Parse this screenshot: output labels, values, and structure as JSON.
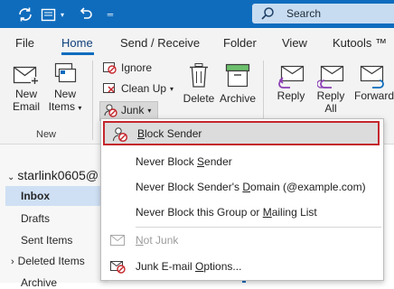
{
  "titlebar": {
    "search_placeholder": "Search",
    "accent": "#0f6cbd"
  },
  "tabs": [
    {
      "label": "File"
    },
    {
      "label": "Home"
    },
    {
      "label": "Send / Receive"
    },
    {
      "label": "Folder"
    },
    {
      "label": "View"
    },
    {
      "label": "Kutools ™"
    }
  ],
  "ribbon": {
    "new_email": "New\nEmail",
    "new_email_l1": "New",
    "new_email_l2": "Email",
    "new_items_l1": "New",
    "new_items_l2": "Items",
    "group_new": "New",
    "ignore": "Ignore",
    "clean_up": "Clean Up",
    "junk": "Junk",
    "delete": "Delete",
    "archive": "Archive",
    "reply": "Reply",
    "reply_all_l1": "Reply",
    "reply_all_l2": "All",
    "forward": "Forward"
  },
  "nav": {
    "account": "starlink0605@",
    "folders": [
      "Inbox",
      "Drafts",
      "Sent Items",
      "Deleted Items",
      "Archive"
    ],
    "selected": "Inbox"
  },
  "junk_menu": {
    "items": [
      {
        "label": "Block Sender",
        "pre": "",
        "key": "B",
        "post": "lock Sender",
        "state": "highlighted"
      },
      {
        "label": "Never Block Sender",
        "pre": "Never Block ",
        "key": "S",
        "post": "ender",
        "state": "normal"
      },
      {
        "label": "Never Block Sender's Domain (@example.com)",
        "pre": "Never Block Sender's ",
        "key": "D",
        "post": "omain (@example.com)",
        "state": "normal"
      },
      {
        "label": "Never Block this Group or Mailing List",
        "pre": "Never Block this Group or ",
        "key": "M",
        "post": "ailing List",
        "state": "normal"
      },
      {
        "label": "Not Junk",
        "pre": "",
        "key": "N",
        "post": "ot Junk",
        "state": "disabled"
      },
      {
        "label": "Junk E-mail Options...",
        "pre": "Junk E-mail ",
        "key": "O",
        "post": "ptions...",
        "state": "normal"
      }
    ],
    "highlight_border": "#c4272d"
  }
}
